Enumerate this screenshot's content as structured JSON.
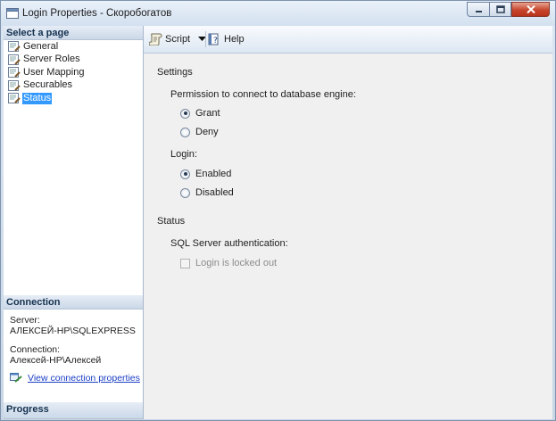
{
  "window": {
    "title": "Login Properties - Скоробогатов"
  },
  "left_pane": {
    "select_page_header": "Select a page",
    "pages": [
      {
        "label": "General",
        "selected": false
      },
      {
        "label": "Server Roles",
        "selected": false
      },
      {
        "label": "User Mapping",
        "selected": false
      },
      {
        "label": "Securables",
        "selected": false
      },
      {
        "label": "Status",
        "selected": true
      }
    ],
    "connection_header": "Connection",
    "server_label": "Server:",
    "server_value": "АЛЕКСЕЙ-HP\\SQLEXPRESS",
    "connection_label": "Connection:",
    "connection_value": "Алексей-HP\\Алексей",
    "view_connection_link": "View connection properties",
    "progress_header": "Progress"
  },
  "toolbar": {
    "script_label": "Script",
    "help_label": "Help"
  },
  "status_page": {
    "settings_heading": "Settings",
    "permission_label": "Permission to connect to database engine:",
    "permission_options": [
      {
        "label": "Grant",
        "checked": true
      },
      {
        "label": "Deny",
        "checked": false
      }
    ],
    "login_label": "Login:",
    "login_options": [
      {
        "label": "Enabled",
        "checked": true
      },
      {
        "label": "Disabled",
        "checked": false
      }
    ],
    "status_heading": "Status",
    "sql_auth_label": "SQL Server authentication:",
    "locked_out_label": "Login is locked out",
    "locked_out_checked": false
  },
  "colors": {
    "selection": "#3399ff",
    "link": "#1a3ec4",
    "section_header_text": "#15314f"
  }
}
